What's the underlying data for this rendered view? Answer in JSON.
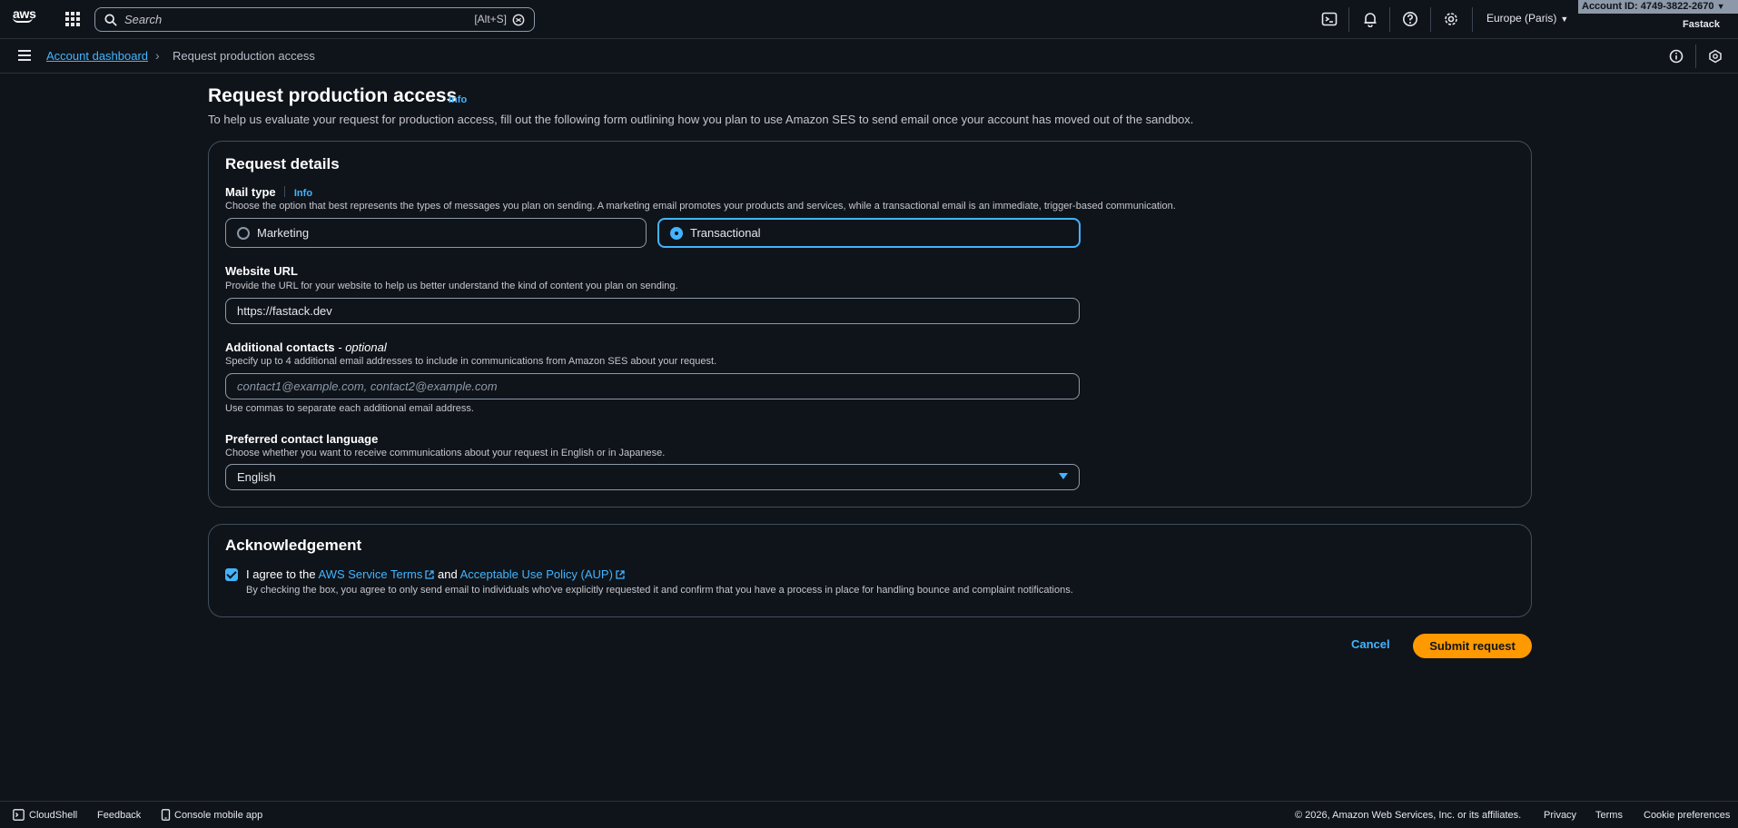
{
  "topnav": {
    "logo_text": "aws",
    "search_placeholder": "Search",
    "search_shortcut": "[Alt+S]",
    "region": "Europe (Paris)",
    "account_id": "Account ID: 4749-3822-2670",
    "account_user": "Fastack"
  },
  "breadcrumb": {
    "parent": "Account dashboard",
    "separator": "›",
    "current": "Request production access"
  },
  "page": {
    "title": "Request production access",
    "info": "Info",
    "description": "To help us evaluate your request for production access, fill out the following form outlining how you plan to use Amazon SES to send email once your account has moved out of the sandbox."
  },
  "request_details": {
    "title": "Request details",
    "mail_type": {
      "label": "Mail type",
      "info": "Info",
      "description": "Choose the option that best represents the types of messages you plan on sending. A marketing email promotes your products and services, while a transactional email is an immediate, trigger-based communication.",
      "options": [
        "Marketing",
        "Transactional"
      ],
      "selected": "Transactional"
    },
    "website_url": {
      "label": "Website URL",
      "description": "Provide the URL for your website to help us better understand the kind of content you plan on sending.",
      "value": "https://fastack.dev"
    },
    "additional_contacts": {
      "label": "Additional contacts",
      "optional": "- optional",
      "description": "Specify up to 4 additional email addresses to include in communications from Amazon SES about your request.",
      "placeholder": "contact1@example.com, contact2@example.com",
      "hint": "Use commas to separate each additional email address."
    },
    "contact_language": {
      "label": "Preferred contact language",
      "description": "Choose whether you want to receive communications about your request in English or in Japanese.",
      "value": "English"
    }
  },
  "acknowledgement": {
    "title": "Acknowledgement",
    "checked": true,
    "text_prefix": "I agree to the ",
    "link1": "AWS Service Terms",
    "text_mid": " and ",
    "link2": "Acceptable Use Policy (AUP)",
    "description": "By checking the box, you agree to only send email to individuals who've explicitly requested it and confirm that you have a process in place for handling bounce and complaint notifications."
  },
  "actions": {
    "cancel": "Cancel",
    "submit": "Submit request"
  },
  "footer": {
    "cloudshell": "CloudShell",
    "feedback": "Feedback",
    "mobile_app": "Console mobile app",
    "copyright": "© 2026, Amazon Web Services, Inc. or its affiliates.",
    "privacy": "Privacy",
    "terms": "Terms",
    "cookies": "Cookie preferences"
  },
  "colors": {
    "background": "#0f141a",
    "link": "#42b4ff",
    "primary_button": "#ff9900",
    "border": "#414d5c"
  }
}
